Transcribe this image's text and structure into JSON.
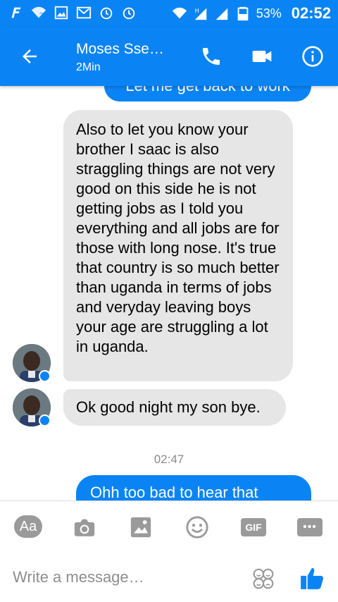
{
  "status_bar": {
    "battery": "53%",
    "time": "02:52",
    "icons": [
      "fb-lite-icon",
      "wifi-question-icon",
      "gallery-icon",
      "gmail-icon",
      "alarm-icon",
      "alarm-icon",
      "wifi-icon",
      "signal-h-icon",
      "signal-icon",
      "battery-icon"
    ]
  },
  "header": {
    "contact_name": "Moses Sse…",
    "status": "2Min",
    "icons": [
      "back-arrow-icon",
      "phone-icon",
      "video-camera-icon",
      "info-icon"
    ],
    "color": "#0a84f5"
  },
  "messages": [
    {
      "direction": "outgoing",
      "text": "Let me get back to work"
    },
    {
      "direction": "incoming",
      "text": "Also to let you know your brother I saac is also straggling things are not very good on this side he is not getting jobs as I told you everything and all jobs are for those with long nose.  It's true  that country is so much better than uganda in terms of jobs and veryday leaving  boys your age are struggling a lot in uganda."
    },
    {
      "direction": "incoming",
      "text": "Ok good night my son bye."
    },
    {
      "direction": "timestamp",
      "text": "02:47"
    },
    {
      "direction": "outgoing",
      "text": "Ohh too bad to hear that"
    }
  ],
  "composer": {
    "aa_label": "Aa",
    "gif_label": "GIF",
    "more_label": "•••",
    "placeholder": "Write a message…",
    "tools": [
      "aa-icon",
      "camera-icon",
      "image-icon",
      "emoji-icon",
      "gif-icon",
      "more-icon",
      "sticker-icon",
      "thumbs-up-icon"
    ]
  },
  "colors": {
    "accent": "#0a84f5",
    "incoming_bubble": "#e6e6e6",
    "icon_gray": "#9a9a9a"
  }
}
